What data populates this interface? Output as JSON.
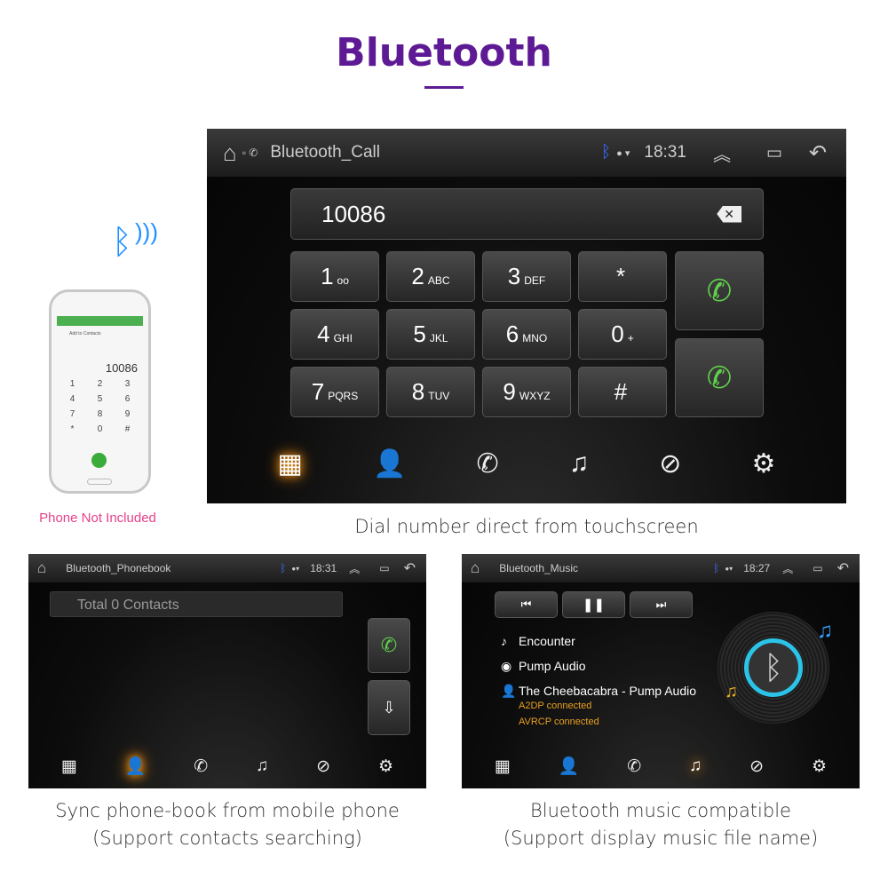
{
  "heading": "Bluetooth",
  "phone": {
    "screen_title": "Add to Contacts",
    "number": "10086",
    "keys": [
      "1",
      "2",
      "3",
      "4",
      "5",
      "6",
      "7",
      "8",
      "9",
      "*",
      "0",
      "#"
    ],
    "note": "Phone Not Included"
  },
  "main": {
    "title": "Bluetooth_Call",
    "time": "18:31",
    "number": "10086",
    "keys": [
      {
        "d": "1",
        "s": "oo"
      },
      {
        "d": "2",
        "s": "ABC"
      },
      {
        "d": "3",
        "s": "DEF"
      },
      {
        "d": "*",
        "s": ""
      },
      {
        "d": "4",
        "s": "GHI"
      },
      {
        "d": "5",
        "s": "JKL"
      },
      {
        "d": "6",
        "s": "MNO"
      },
      {
        "d": "0",
        "s": "+"
      },
      {
        "d": "7",
        "s": "PQRS"
      },
      {
        "d": "8",
        "s": "TUV"
      },
      {
        "d": "9",
        "s": "WXYZ"
      },
      {
        "d": "#",
        "s": ""
      }
    ],
    "caption": "Dial number direct from touchscreen"
  },
  "nav": [
    "dialpad-icon",
    "contacts-icon",
    "call-log-icon",
    "music-icon",
    "link-icon",
    "settings-icon"
  ],
  "phonebook": {
    "title": "Bluetooth_Phonebook",
    "time": "18:31",
    "search_placeholder": "Total 0 Contacts",
    "caption1": "Sync phone-book from mobile phone",
    "caption2": "(Support contacts searching)"
  },
  "music": {
    "title": "Bluetooth_Music",
    "time": "18:27",
    "song": "Encounter",
    "album": "Pump Audio",
    "artist": "The Cheebacabra - Pump Audio",
    "status1": "A2DP connected",
    "status2": "AVRCP connected",
    "caption1": "Bluetooth music compatible",
    "caption2": "(Support display music file name)"
  },
  "colors": {
    "heading": "#5e1a95",
    "active_glow": "#ff9d1c",
    "call_green": "#5fd14a",
    "note_pink": "#e8408a",
    "status_orange": "#e8a020"
  }
}
